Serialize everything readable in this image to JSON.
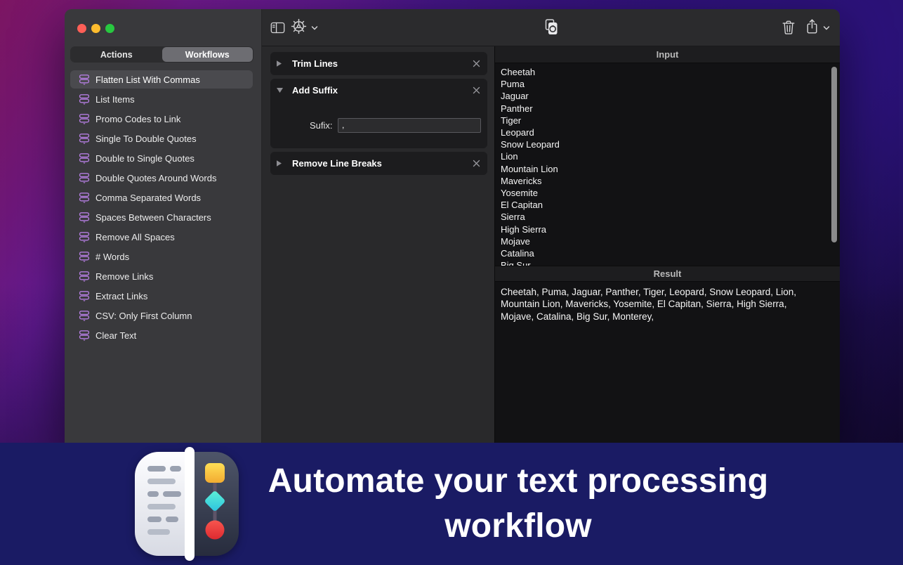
{
  "sidebar": {
    "tabs": [
      {
        "label": "Actions",
        "selected": false
      },
      {
        "label": "Workflows",
        "selected": true
      }
    ],
    "items": [
      {
        "label": "Flatten List With Commas",
        "selected": true
      },
      {
        "label": "List Items",
        "selected": false
      },
      {
        "label": "Promo Codes to Link",
        "selected": false
      },
      {
        "label": "Single To Double Quotes",
        "selected": false
      },
      {
        "label": "Double to Single Quotes",
        "selected": false
      },
      {
        "label": "Double Quotes Around Words",
        "selected": false
      },
      {
        "label": "Comma Separated Words",
        "selected": false
      },
      {
        "label": "Spaces Between Characters",
        "selected": false
      },
      {
        "label": "Remove All Spaces",
        "selected": false
      },
      {
        "label": "# Words",
        "selected": false
      },
      {
        "label": "Remove Links",
        "selected": false
      },
      {
        "label": "Extract Links",
        "selected": false
      },
      {
        "label": "CSV: Only First Column",
        "selected": false
      },
      {
        "label": "Clear Text",
        "selected": false
      }
    ]
  },
  "toolbar": {
    "icons": {
      "left": [
        "toggle-sidebar-icon",
        "gear-icon",
        "chevron-down-icon"
      ],
      "center": [
        "run-workflow-icon"
      ],
      "right": [
        "trash-icon",
        "share-icon",
        "chevron-down-icon"
      ]
    }
  },
  "steps": {
    "card1": {
      "title": "Trim Lines",
      "state": "collapsed"
    },
    "card2": {
      "title": "Add Suffix",
      "state": "expanded",
      "field_label": "Sufix:",
      "field_value": ","
    },
    "card3": {
      "title": "Remove Line Breaks",
      "state": "collapsed"
    }
  },
  "io": {
    "input_header": "Input",
    "input_lines": [
      "Cheetah",
      "Puma",
      "Jaguar",
      "Panther",
      "Tiger",
      "Leopard",
      "Snow Leopard",
      "Lion",
      "Mountain Lion",
      "Mavericks",
      "Yosemite",
      "El Capitan",
      "Sierra",
      "High Sierra",
      "Mojave",
      "Catalina",
      "Big Sur"
    ],
    "result_header": "Result",
    "result_lines": [
      "Cheetah, Puma, Jaguar, Panther, Tiger, Leopard, Snow Leopard, Lion,",
      "Mountain Lion, Mavericks, Yosemite, El Capitan, Sierra, High Sierra,",
      "Mojave, Catalina, Big Sur, Monterey,"
    ]
  },
  "banner": {
    "headline_lines": [
      "Automate your text processing",
      "workflow"
    ]
  },
  "colors": {
    "accent_purple": "#b47de0",
    "banner_bg": "#1a1b64",
    "traffic_red": "#ff5f57",
    "traffic_yellow": "#febc2e",
    "traffic_green": "#28c840",
    "icon_yellow": "#fbcf44",
    "icon_teal": "#3ee0cf",
    "icon_red": "#f2433d"
  }
}
